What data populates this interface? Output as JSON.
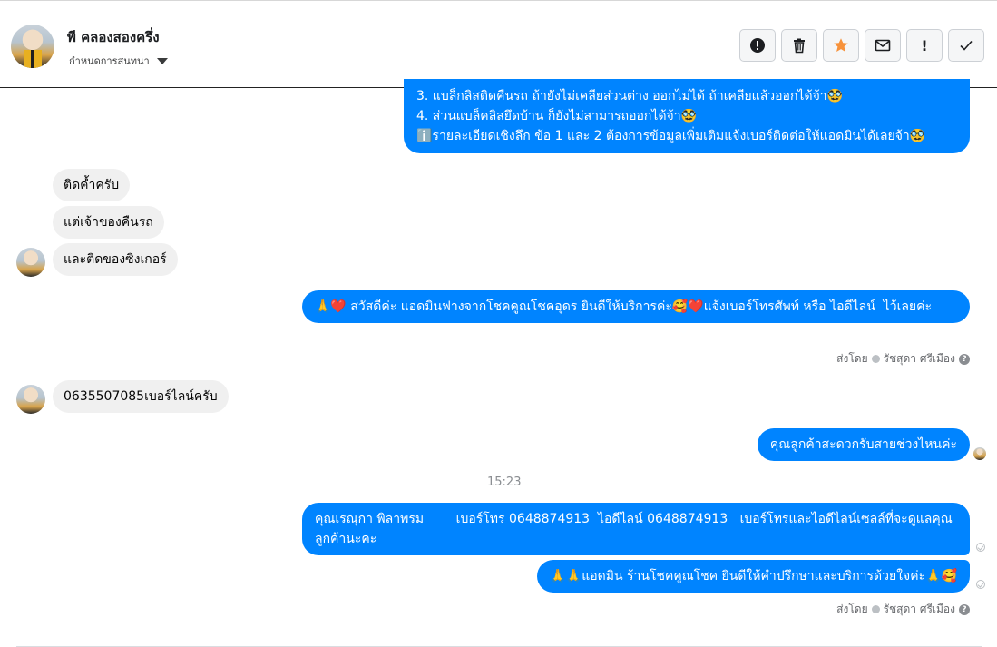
{
  "header": {
    "name": "พี คลองสองครึ่ง",
    "subtitle": "กำหนดการสนทนา",
    "toolbar": {
      "alert_icon": "!",
      "important_icon": "!"
    }
  },
  "messages": {
    "m1": "3. แบล็กลิสติดคืนรถ ถ้ายังไม่เคลียส่วนต่าง ออกไม่ได้ ถ้าเคลียแล้วออกได้จ้า🥸\n4. ส่วนแบล็คลิสยึดบ้าน ก็ยังไม่สามารถออกได้จ้า🥸\nℹ️รายละเอียดเชิงลึก ข้อ 1 และ 2 ต้องการข้อมูลเพิ่มเติมแจ้งเบอร์ติดต่อให้แอดมินได้เลยจ้า🥸",
    "m2": "ติดค้ำครับ",
    "m3": "แต่เจ้าของคืนรถ",
    "m4": "และติดของซิงเกอร์",
    "m5": "🙏❤️ สวัสดีค่ะ แอดมินฟางจากโชคคูณโชคอุดร ยินดีให้บริการค่ะ🥰❤️แจ้งเบอร์โทรศัพท์ หรือ ไอดีไลน์  ไว้เลยค่ะ",
    "m6": "0635507085เบอร์ไลน์ครับ",
    "m7": "คุณลูกค้าสะดวกรับสายช่วงไหนค่ะ",
    "m8": "คุณเรณุกา พิลาพรม        เบอร์โทร 0648874913  ไอดีไลน์ 0648874913   เบอร์โทรและไอดีไลน์เซลล์ที่จะดูแลคุณลูกค้านะคะ",
    "m9": "🙏🙏แอดมิน ร้านโชคคูณโชค ยินดีให้คำปรึกษาและบริการด้วยใจค่ะ🙏🥰"
  },
  "sent_by": {
    "label": "ส่งโดย",
    "name": "รัชสุดา ศรีเมือง",
    "help": "?"
  },
  "time_separator": "15:23"
}
